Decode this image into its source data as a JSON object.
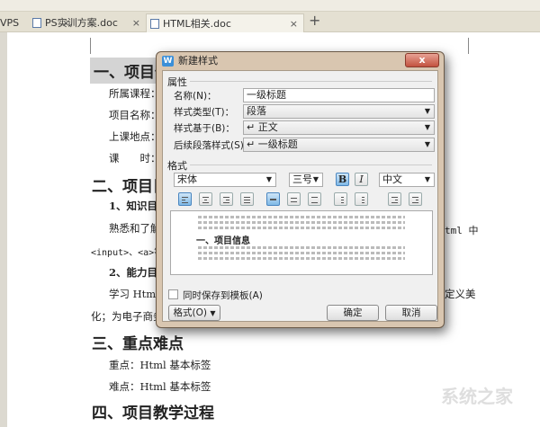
{
  "tabs": [
    {
      "label": "VPS"
    },
    {
      "label": "PS实训方案.doc"
    },
    {
      "label": "HTML相关.doc",
      "active": true
    }
  ],
  "tab_close": "×",
  "new_tab": "+",
  "document": {
    "h1": "一、项目信息",
    "lines": [
      "所属课程：",
      "项目名称：",
      "上课地点：",
      "课　　时："
    ],
    "h2": "二、项目目标",
    "s1": "1、知识目标",
    "p1": "熟悉和了解",
    "p1_right": "tml 中",
    "p2": "<input>、<a>等",
    "s2": "2、能力目标",
    "p3": "学习 Html 的",
    "p3_right": "定义美",
    "p4": "化；为电子商务",
    "h3": "三、重点难点",
    "k1": "重点：Html 基本标签",
    "k2": "难点：Html 基本标签",
    "h4": "四、项目教学过程"
  },
  "dialog": {
    "title": "新建样式",
    "close": "x",
    "properties_label": "属性",
    "name_label": "名称(N)：",
    "name_value": "一级标题",
    "type_label": "样式类型(T)：",
    "type_value": "段落",
    "based_label": "样式基于(B)：",
    "based_value": "↵ 正文",
    "next_label": "后续段落样式(S)：",
    "next_value": "↵ 一级标题",
    "format_label": "格式",
    "font": "宋体",
    "size": "三号",
    "bold": "B",
    "italic": "I",
    "lang": "中文",
    "preview_heading": "一、项目信息",
    "save_template": "同时保存到模板(A)",
    "format_button": "格式(O)",
    "ok": "确定",
    "cancel": "取消"
  },
  "watermark": "系统之家"
}
